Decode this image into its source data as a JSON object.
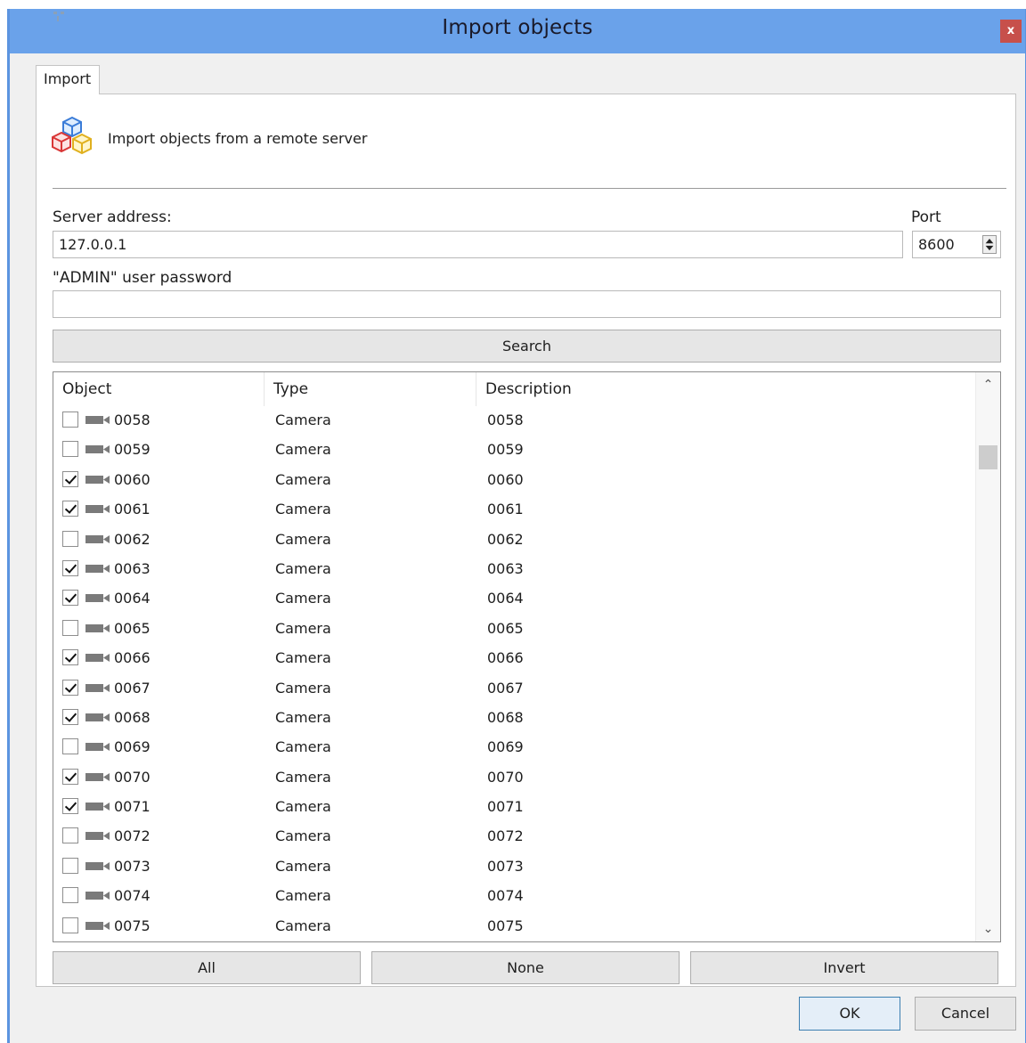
{
  "window": {
    "title": "Import objects"
  },
  "tab": {
    "label": "Import"
  },
  "header": {
    "description": "Import objects from a remote server"
  },
  "form": {
    "server_label": "Server address:",
    "server_value": "127.0.0.1",
    "port_label": "Port",
    "port_value": "8600",
    "password_label": "\"ADMIN\" user password",
    "password_value": ""
  },
  "search_button": "Search",
  "table": {
    "columns": [
      "Object",
      "Type",
      "Description"
    ],
    "rows": [
      {
        "name": "0058",
        "type": "Camera",
        "description": "0058",
        "checked": false
      },
      {
        "name": "0059",
        "type": "Camera",
        "description": "0059",
        "checked": false
      },
      {
        "name": "0060",
        "type": "Camera",
        "description": "0060",
        "checked": true
      },
      {
        "name": "0061",
        "type": "Camera",
        "description": "0061",
        "checked": true
      },
      {
        "name": "0062",
        "type": "Camera",
        "description": "0062",
        "checked": false
      },
      {
        "name": "0063",
        "type": "Camera",
        "description": "0063",
        "checked": true
      },
      {
        "name": "0064",
        "type": "Camera",
        "description": "0064",
        "checked": true
      },
      {
        "name": "0065",
        "type": "Camera",
        "description": "0065",
        "checked": false
      },
      {
        "name": "0066",
        "type": "Camera",
        "description": "0066",
        "checked": true
      },
      {
        "name": "0067",
        "type": "Camera",
        "description": "0067",
        "checked": true
      },
      {
        "name": "0068",
        "type": "Camera",
        "description": "0068",
        "checked": true
      },
      {
        "name": "0069",
        "type": "Camera",
        "description": "0069",
        "checked": false
      },
      {
        "name": "0070",
        "type": "Camera",
        "description": "0070",
        "checked": true
      },
      {
        "name": "0071",
        "type": "Camera",
        "description": "0071",
        "checked": true
      },
      {
        "name": "0072",
        "type": "Camera",
        "description": "0072",
        "checked": false
      },
      {
        "name": "0073",
        "type": "Camera",
        "description": "0073",
        "checked": false
      },
      {
        "name": "0074",
        "type": "Camera",
        "description": "0074",
        "checked": false
      },
      {
        "name": "0075",
        "type": "Camera",
        "description": "0075",
        "checked": false
      }
    ]
  },
  "selection_buttons": {
    "all": "All",
    "none": "None",
    "invert": "Invert"
  },
  "footer": {
    "ok": "OK",
    "cancel": "Cancel"
  },
  "icons": {
    "close": "close-icon",
    "header": "cubes-icon",
    "row": "camera-icon",
    "spin": "spin-arrows-icon"
  },
  "colors": {
    "titlebar": "#6aa2ea",
    "close_button": "#c7504b",
    "window_border": "#5b94e0",
    "dialog_background": "#f0f0f0"
  }
}
